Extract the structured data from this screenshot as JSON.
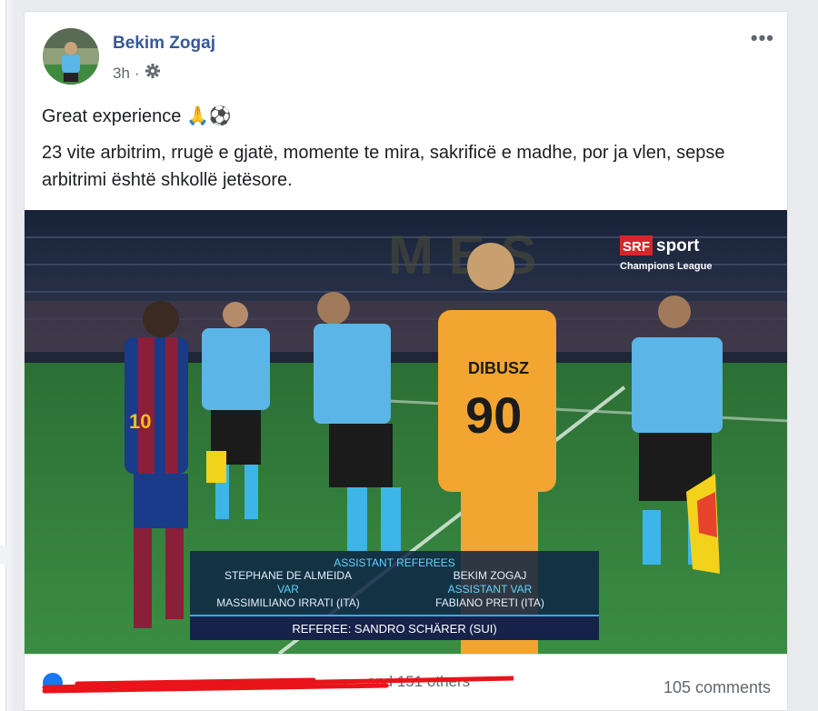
{
  "post": {
    "author": "Bekim Zogaj",
    "time": "3h",
    "privacy_icon": "gear-icon",
    "more_label": "•••",
    "text_line1": "Great experience 🙏⚽",
    "text_body": "23 vite arbitrim, rrugë e gjatë, momente te mira, sakrificë e madhe, por ja vlen, sepse arbitrimi është shkollë jetësore."
  },
  "photo": {
    "broadcaster_logo": "SRF",
    "broadcaster_name": "sport",
    "broadcaster_sub": "Champions League",
    "goalkeeper_name": "DIBUSZ",
    "goalkeeper_number": "90",
    "messi_number": "10",
    "overlay": {
      "heading": "ASSISTANT REFEREES",
      "assistant1": "STEPHANE DE ALMEIDA",
      "assistant2": "BEKIM ZOGAJ",
      "var_label": "VAR",
      "assistant_var_label": "ASSISTANT VAR",
      "var_name": "MASSIMILIANO IRRATI (ITA)",
      "assistant_var_name": "FABIANO PRETI (ITA)",
      "referee": "REFEREE: SANDRO SCHÄRER (SUI)"
    }
  },
  "footer": {
    "reactions_text": "and 151 others",
    "comments": "105 comments"
  },
  "colors": {
    "link": "#385898",
    "pitch": "#2f7d3a",
    "ref_shirt": "#5bb5e6",
    "keeper_shirt": "#f2a531"
  }
}
